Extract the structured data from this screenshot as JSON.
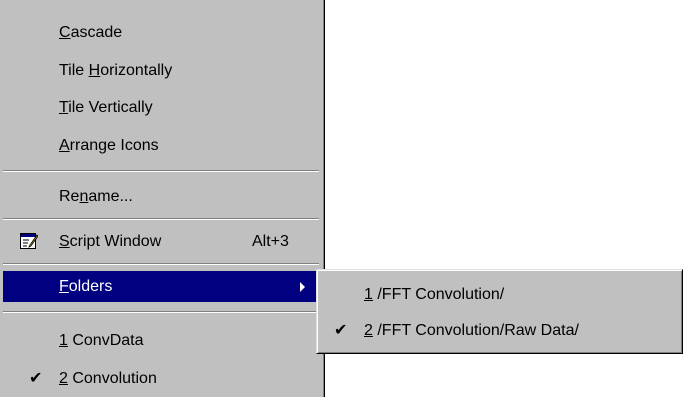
{
  "main_menu": {
    "items": [
      {
        "pre": "",
        "key": "C",
        "post": "ascade"
      },
      {
        "pre": "Tile ",
        "key": "H",
        "post": "orizontally"
      },
      {
        "pre": "",
        "key": "T",
        "post": "ile Vertically"
      },
      {
        "pre": "",
        "key": "A",
        "post": "rrange Icons"
      },
      {
        "pre": "Re",
        "key": "n",
        "post": "ame..."
      },
      {
        "pre": "",
        "key": "S",
        "post": "cript Window",
        "shortcut": "Alt+3",
        "icon": "script-window-icon"
      },
      {
        "pre": "",
        "key": "F",
        "post": "olders",
        "submenu": true,
        "selected": true
      },
      {
        "pre": "",
        "key": "1",
        "post": " ConvData"
      },
      {
        "pre": "",
        "key": "2",
        "post": " Convolution",
        "check": "✔"
      }
    ]
  },
  "folders_submenu": {
    "items": [
      {
        "pre": "",
        "key": "1",
        "post": " /FFT Convolution/"
      },
      {
        "pre": "",
        "key": "2",
        "post": " /FFT Convolution/Raw Data/",
        "check": "✔"
      }
    ]
  },
  "colors": {
    "menu_bg": "#c0c0c0",
    "highlight": "#000080",
    "highlight_text": "#ffffff"
  }
}
